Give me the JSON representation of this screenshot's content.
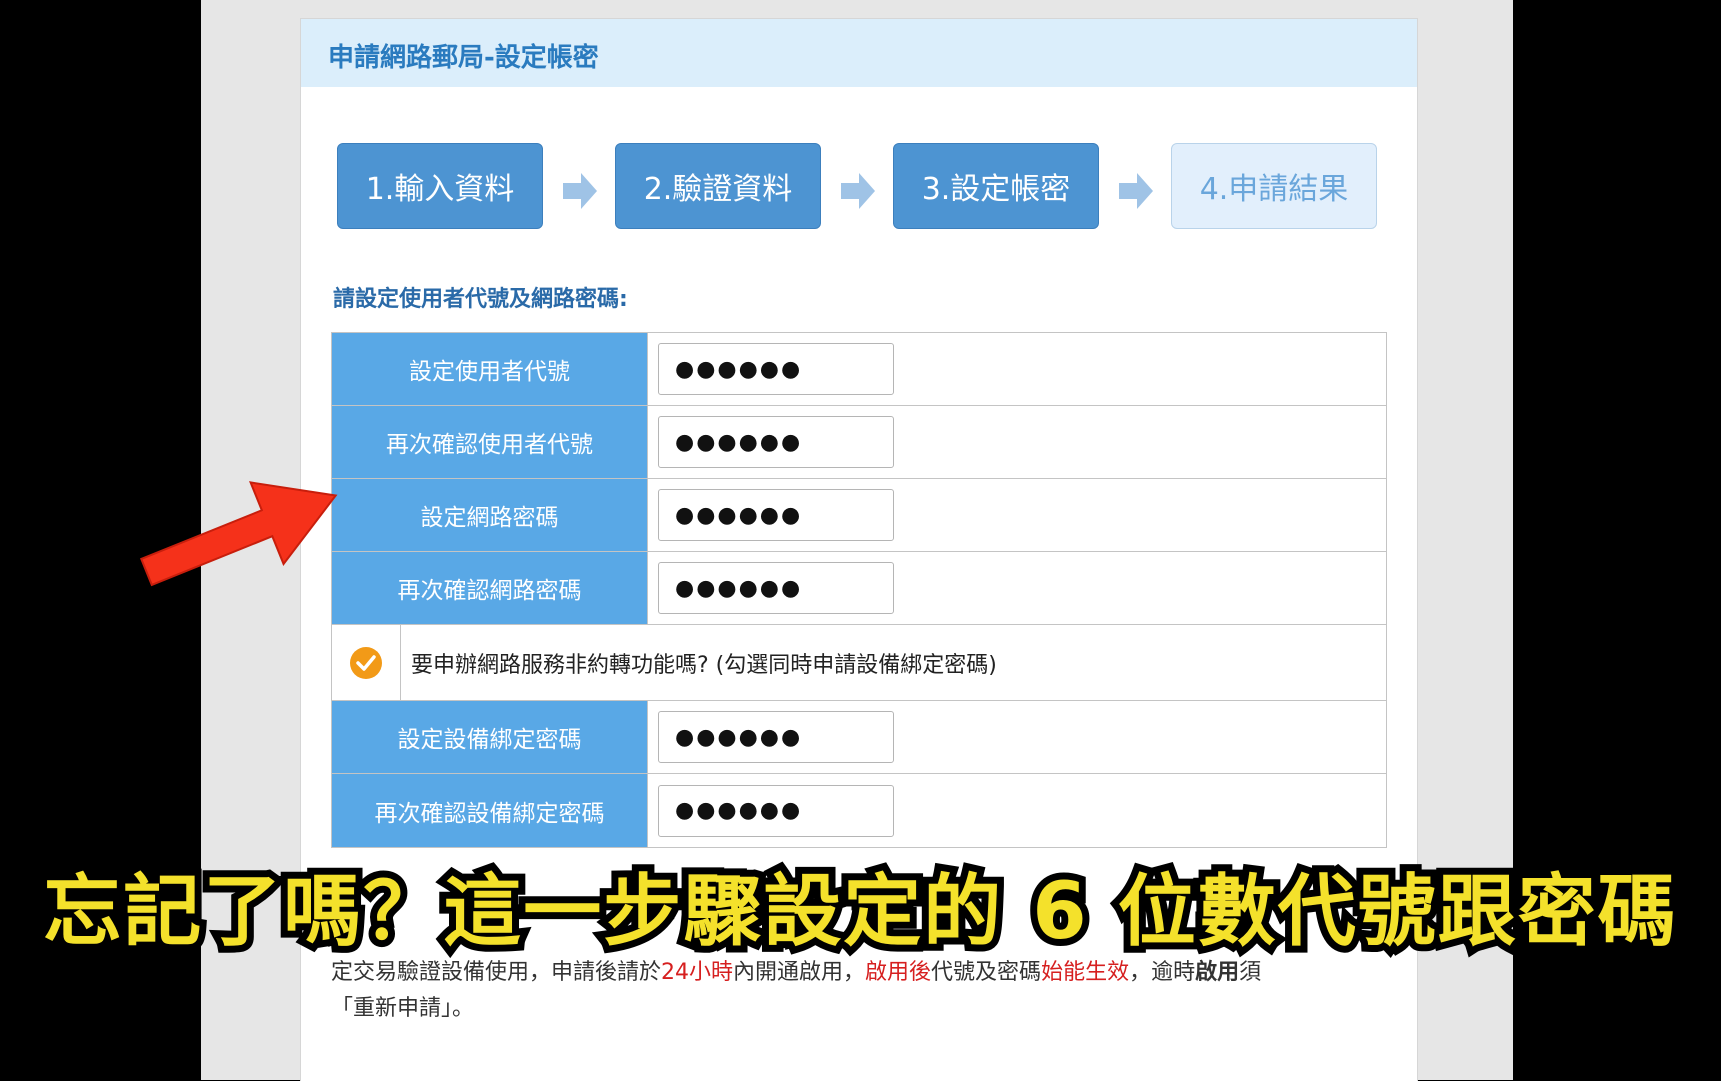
{
  "panel": {
    "title": "申請網路郵局-設定帳密"
  },
  "steps": [
    {
      "label": "1.輸入資料",
      "state": "done"
    },
    {
      "label": "2.驗證資料",
      "state": "done"
    },
    {
      "label": "3.設定帳密",
      "state": "current"
    },
    {
      "label": "4.申請結果",
      "state": "pending"
    }
  ],
  "prompt": "請設定使用者代號及網路密碼:",
  "fields": {
    "user_id": {
      "label": "設定使用者代號",
      "value": "●●●●●●"
    },
    "user_id_confirm": {
      "label": "再次確認使用者代號",
      "value": "●●●●●●"
    },
    "password": {
      "label": "設定網路密碼",
      "value": "●●●●●●"
    },
    "password_confirm": {
      "label": "再次確認網路密碼",
      "value": "●●●●●●"
    },
    "device_password": {
      "label": "設定設備綁定密碼",
      "value": "●●●●●●"
    },
    "device_password_confirm": {
      "label": "再次確認設備綁定密碼",
      "value": "●●●●●●"
    }
  },
  "checkbox": {
    "label": "要申辦網路服務非約轉功能嗎? (勾選同時申請設備綁定密碼)",
    "checked": true
  },
  "notes": {
    "line1_part1": "定交易驗證設備使用，申請後請於",
    "line1_red1": "24小時",
    "line1_part2": "內開通啟用，",
    "line1_red2": "啟用後",
    "line1_part3": "代號及密碼",
    "line1_red3": "始能生效",
    "line1_part4": "，逾時",
    "line1_bold": "啟用",
    "line1_part5": "須",
    "line2": "「重新申請」。"
  },
  "caption": "忘記了嗎？這一步驟設定的 6 位數代號跟密碼",
  "colors": {
    "step_active": "#4d94d2",
    "step_pending": "#e2effc",
    "label_bg": "#59a8e6",
    "header_bg": "#dbeefb",
    "check": "#f29a17",
    "pointer_arrow": "#f5311a",
    "caption_fill": "#f4e12b"
  }
}
